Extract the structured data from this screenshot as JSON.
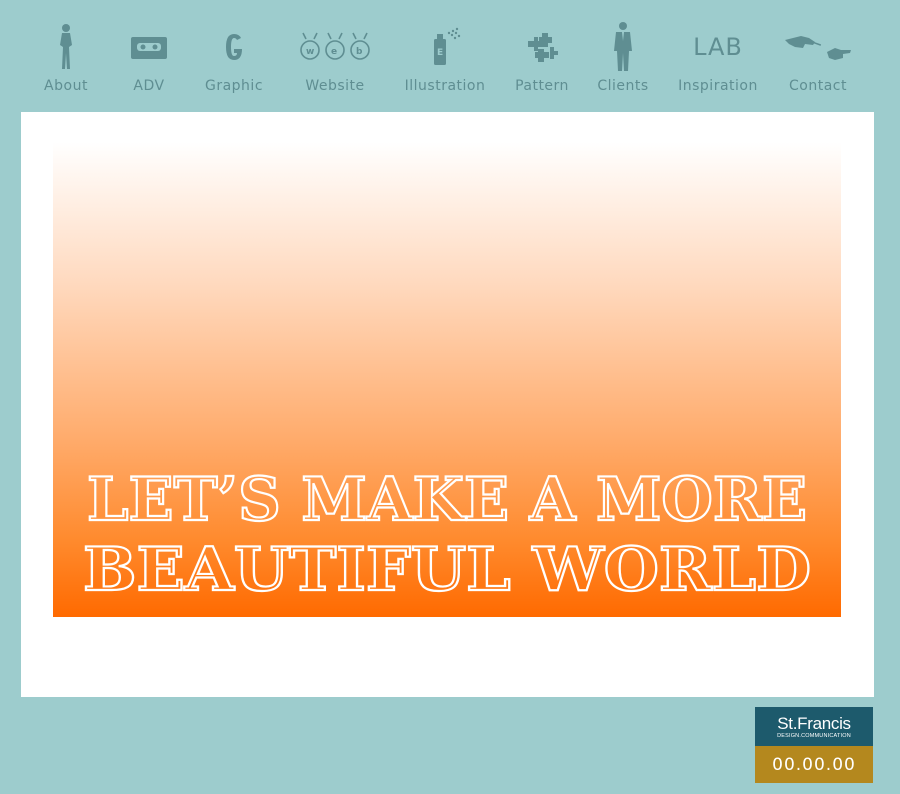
{
  "nav": {
    "items": [
      {
        "label": "About",
        "icon": "woman-silhouette-icon"
      },
      {
        "label": "ADV",
        "icon": "cassette-tape-icon"
      },
      {
        "label": "Graphic",
        "icon": "letter-g-icon"
      },
      {
        "label": "Website",
        "icon": "www-bugs-icon"
      },
      {
        "label": "Illustration",
        "icon": "spray-can-icon"
      },
      {
        "label": "Pattern",
        "icon": "puzzle-pieces-icon"
      },
      {
        "label": "Clients",
        "icon": "businessman-icon"
      },
      {
        "label": "Inspiration",
        "icon": "lab-text-icon",
        "icon_text": "LAB"
      },
      {
        "label": "Contact",
        "icon": "hand-pointing-icon"
      }
    ]
  },
  "banner": {
    "line1": "LET’S MAKE A MORE",
    "line2": "BEAUTIFUL WORLD"
  },
  "badge": {
    "name": "St.Francis",
    "subtitle": "DESIGN.COMMUNICATION",
    "counter": "00.00.00"
  },
  "colors": {
    "background": "#9dcccd",
    "nav_text": "#5f8e92",
    "badge_top": "#1d5a6c",
    "badge_bottom": "#b4881e",
    "banner_orange": "#ff6a00"
  }
}
